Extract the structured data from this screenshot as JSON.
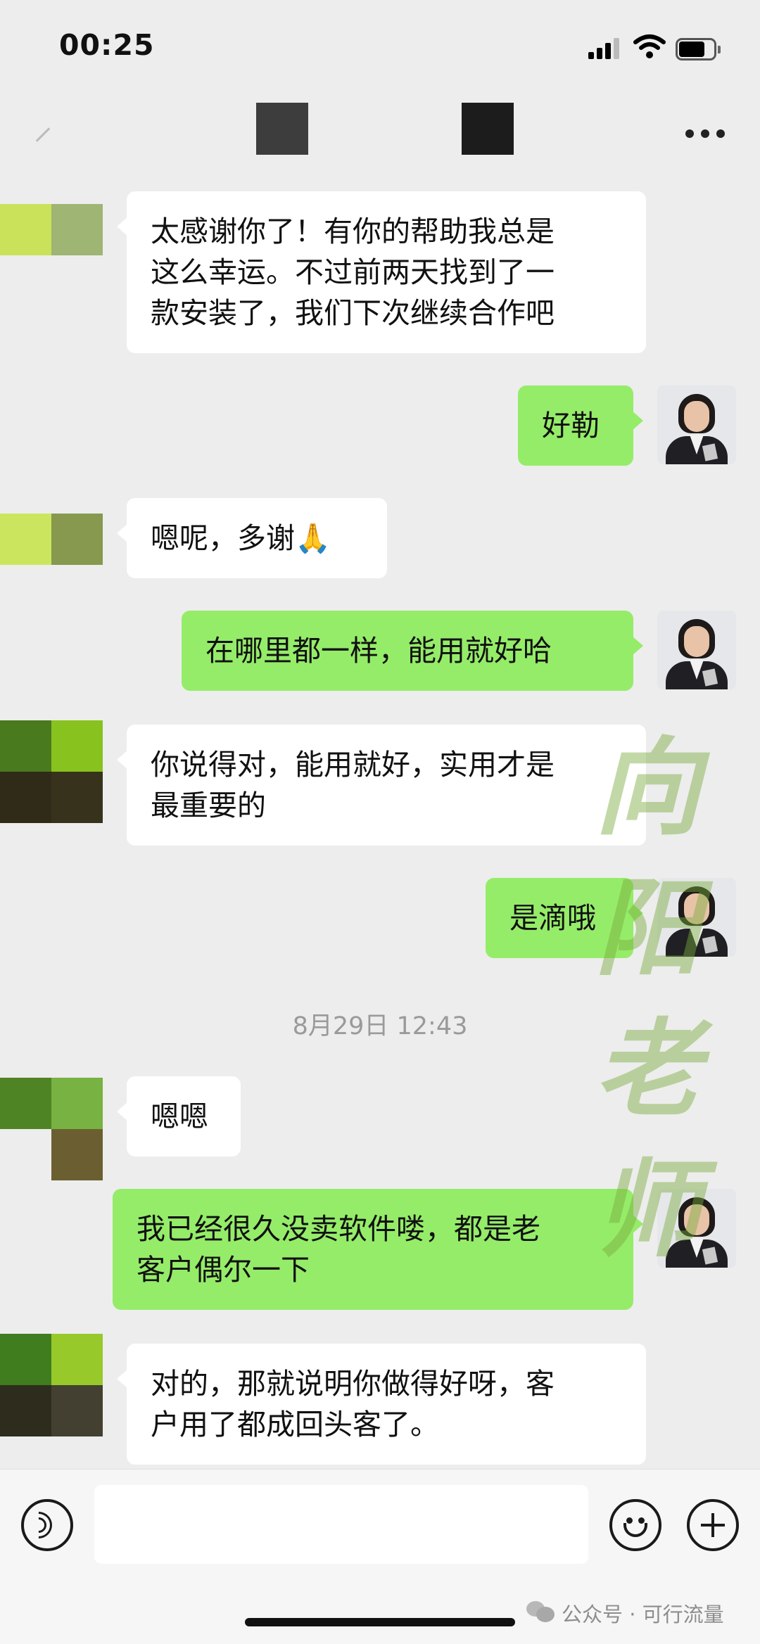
{
  "status_bar": {
    "time": "00:25"
  },
  "chat": {
    "messages": [
      {
        "side": "in",
        "text": "太感谢你了！有你的帮助我总是\n这么幸运。不过前两天找到了一\n款安装了，我们下次继续合作吧"
      },
      {
        "side": "out",
        "text": "好勒"
      },
      {
        "side": "in",
        "text": "嗯呢，多谢🙏"
      },
      {
        "side": "out",
        "text": "在哪里都一样，能用就好哈"
      },
      {
        "side": "in",
        "text": "你说得对，能用就好，实用才是\n最重要的"
      },
      {
        "side": "out",
        "text": "是滴哦"
      },
      {
        "side": "in",
        "text": "嗯嗯"
      },
      {
        "side": "out",
        "text": "我已经很久没卖软件喽，都是老\n客户偶尔一下"
      },
      {
        "side": "in",
        "text": "对的，那就说明你做得好呀，客\n户用了都成回头客了。"
      }
    ],
    "timestamp": "8月29日 12:43"
  },
  "watermark": {
    "chars": [
      "向",
      "阳",
      "老",
      "师"
    ]
  },
  "input_bar": {
    "voice_icon": "voice-icon",
    "emoji_icon": "emoji-icon",
    "plus_icon": "plus-icon",
    "text_value": ""
  },
  "footer": {
    "source_label": "公众号 · 可行流量"
  },
  "colors": {
    "incoming_bubble": "#ffffff",
    "outgoing_bubble": "#95ec69",
    "background": "#ededed"
  }
}
